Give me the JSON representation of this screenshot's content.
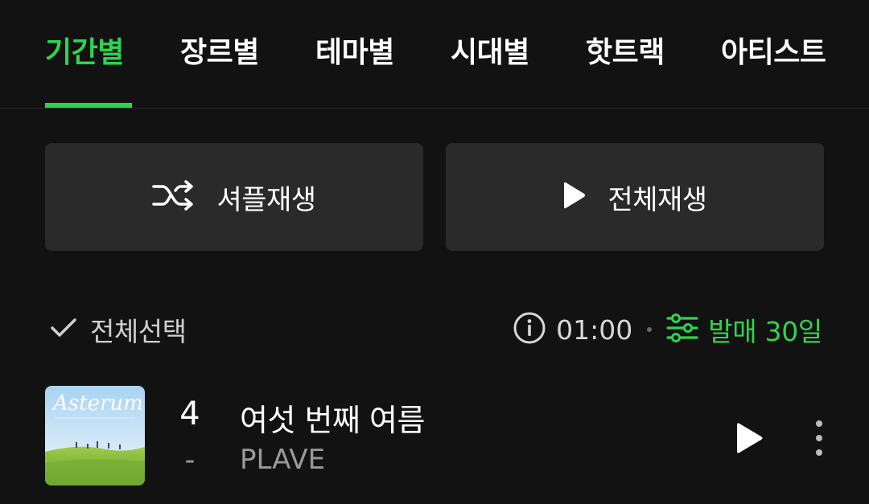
{
  "tabs": [
    {
      "label": "기간별",
      "active": true
    },
    {
      "label": "장르별",
      "active": false
    },
    {
      "label": "테마별",
      "active": false
    },
    {
      "label": "시대별",
      "active": false
    },
    {
      "label": "핫트랙",
      "active": false
    },
    {
      "label": "아티스트",
      "active": false
    }
  ],
  "actions": {
    "shuffle_label": "셔플재생",
    "play_all_label": "전체재생"
  },
  "options": {
    "select_all_label": "전체선택",
    "duration": "01:00",
    "filter_label": "발매 30일"
  },
  "track": {
    "rank": "4",
    "rank_change": "-",
    "title": "여섯 번째 여름",
    "artist": "PLAVE",
    "album_art_text": "Asterum"
  },
  "colors": {
    "accent": "#2fd44e",
    "background": "#121212",
    "button_bg": "#2a2a2a"
  },
  "icons": {
    "shuffle": "shuffle-icon",
    "play": "play-icon",
    "check": "check-icon",
    "info": "info-icon",
    "filter": "sliders-icon",
    "more": "more-vertical-icon"
  }
}
